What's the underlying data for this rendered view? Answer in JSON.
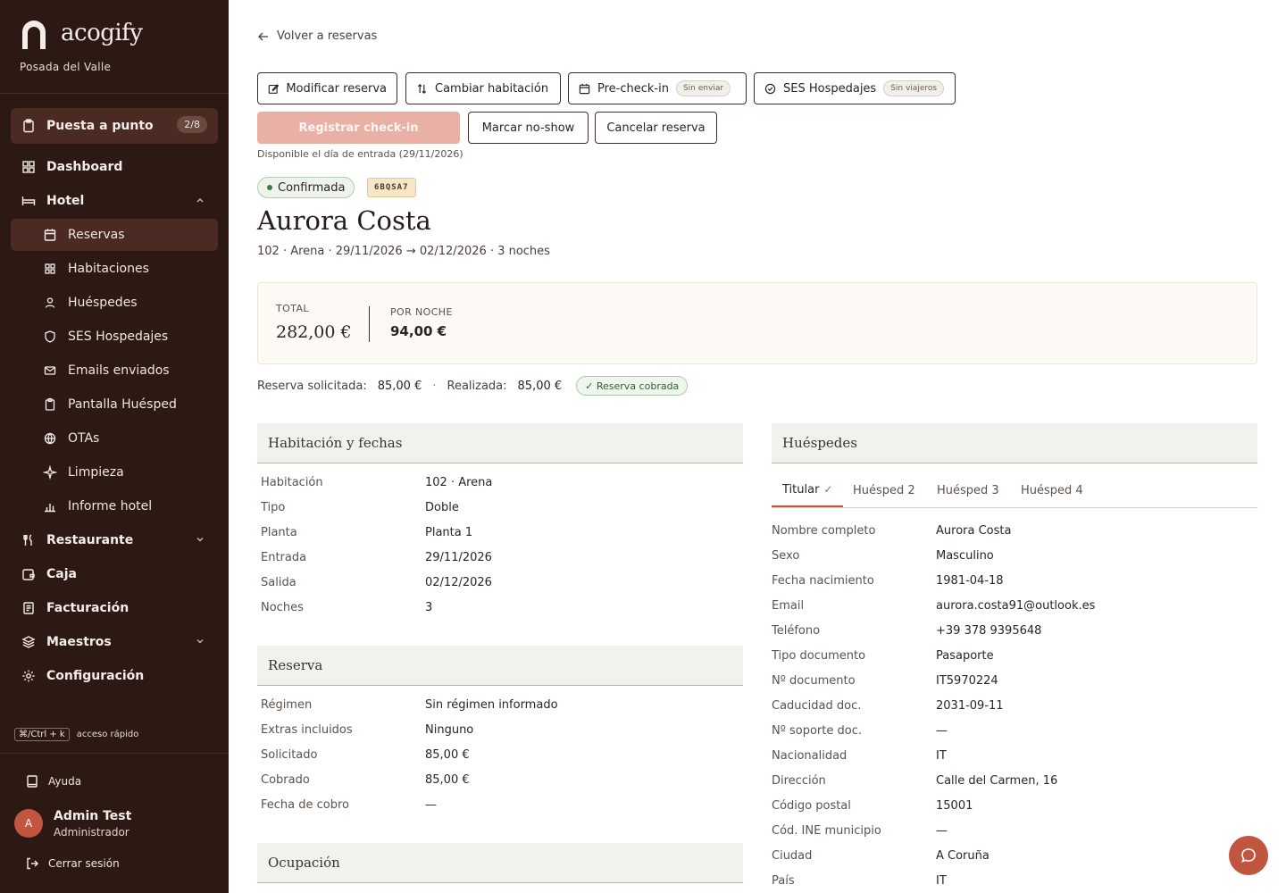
{
  "brand": {
    "name": "acogify",
    "subtitle": "Posada del Valle"
  },
  "sidebar": {
    "primary": {
      "label": "Puesta a punto",
      "badge": "2/8"
    },
    "items": [
      {
        "label": "Dashboard"
      },
      {
        "label": "Hotel"
      },
      {
        "label": "Reservas"
      },
      {
        "label": "Habitaciones"
      },
      {
        "label": "Huéspedes"
      },
      {
        "label": "SES Hospedajes"
      },
      {
        "label": "Emails enviados"
      },
      {
        "label": "Pantalla Huésped"
      },
      {
        "label": "OTAs"
      },
      {
        "label": "Limpieza"
      },
      {
        "label": "Informe hotel"
      },
      {
        "label": "Restaurante"
      },
      {
        "label": "Caja"
      },
      {
        "label": "Facturación"
      },
      {
        "label": "Maestros"
      },
      {
        "label": "Configuración"
      }
    ],
    "shortcut": {
      "keys": "⌘/Ctrl + k",
      "label": "acceso rápido"
    },
    "help": "Ayuda",
    "user": {
      "initial": "A",
      "name": "Admin Test",
      "role": "Administrador"
    },
    "logout": "Cerrar sesión"
  },
  "main": {
    "back": "Volver a reservas",
    "actions": {
      "modify": "Modificar reserva",
      "change_room": "Cambiar habitación",
      "precheckin": "Pre-check-in",
      "precheckin_pill": "Sin enviar",
      "ses": "SES Hospedajes",
      "ses_pill": "Sin viajeros",
      "checkin": "Registrar check-in",
      "noshow": "Marcar no-show",
      "cancel": "Cancelar reserva"
    },
    "checkin_hint": "Disponible el día de entrada (29/11/2026)",
    "status": "Confirmada",
    "code": "6BQSA7",
    "guest_name": "Aurora Costa",
    "meta": "102 · Arena · 29/11/2026 → 02/12/2026 · 3 noches",
    "totals": {
      "total_label": "TOTAL",
      "total_value": "282,00 €",
      "night_label": "POR NOCHE",
      "night_value": "94,00 €"
    },
    "payment": {
      "requested_label": "Reserva solicitada:",
      "requested_value": "85,00 €",
      "sep": "·",
      "done_label": "Realizada:",
      "done_value": "85,00 €",
      "badge": "✓ Reserva cobrada"
    },
    "room_card": {
      "title": "Habitación y fechas",
      "rows": [
        {
          "label": "Habitación",
          "value": "102 · Arena"
        },
        {
          "label": "Tipo",
          "value": "Doble"
        },
        {
          "label": "Planta",
          "value": "Planta 1"
        },
        {
          "label": "Entrada",
          "value": "29/11/2026"
        },
        {
          "label": "Salida",
          "value": "02/12/2026"
        },
        {
          "label": "Noches",
          "value": "3"
        }
      ]
    },
    "booking_card": {
      "title": "Reserva",
      "rows": [
        {
          "label": "Régimen",
          "value": "Sin régimen informado"
        },
        {
          "label": "Extras incluidos",
          "value": "Ninguno"
        },
        {
          "label": "Solicitado",
          "value": "85,00 €"
        },
        {
          "label": "Cobrado",
          "value": "85,00 €"
        },
        {
          "label": "Fecha de cobro",
          "value": "—"
        }
      ]
    },
    "occupancy_card": {
      "title": "Ocupación"
    },
    "guests_card": {
      "title": "Huéspedes",
      "tabs": [
        {
          "label": "Titular",
          "check": "✓"
        },
        {
          "label": "Huésped 2"
        },
        {
          "label": "Huésped 3"
        },
        {
          "label": "Huésped 4"
        }
      ],
      "rows": [
        {
          "label": "Nombre completo",
          "value": "Aurora Costa"
        },
        {
          "label": "Sexo",
          "value": "Masculino"
        },
        {
          "label": "Fecha nacimiento",
          "value": "1981-04-18"
        },
        {
          "label": "Email",
          "value": "aurora.costa91@outlook.es"
        },
        {
          "label": "Teléfono",
          "value": "+39 378 9395648"
        },
        {
          "label": "Tipo documento",
          "value": "Pasaporte"
        },
        {
          "label": "Nº documento",
          "value": "IT5970224"
        },
        {
          "label": "Caducidad doc.",
          "value": "2031-09-11"
        },
        {
          "label": "Nº soporte doc.",
          "value": "—"
        },
        {
          "label": "Nacionalidad",
          "value": "IT"
        },
        {
          "label": "Dirección",
          "value": "Calle del Carmen, 16"
        },
        {
          "label": "Código postal",
          "value": "15001"
        },
        {
          "label": "Cód. INE municipio",
          "value": "—"
        },
        {
          "label": "Ciudad",
          "value": "A Coruña"
        },
        {
          "label": "País",
          "value": "IT"
        }
      ]
    }
  },
  "colors": {
    "sidebar": "#2c1914",
    "accent": "#c0563f",
    "active": "#4a2a22"
  }
}
